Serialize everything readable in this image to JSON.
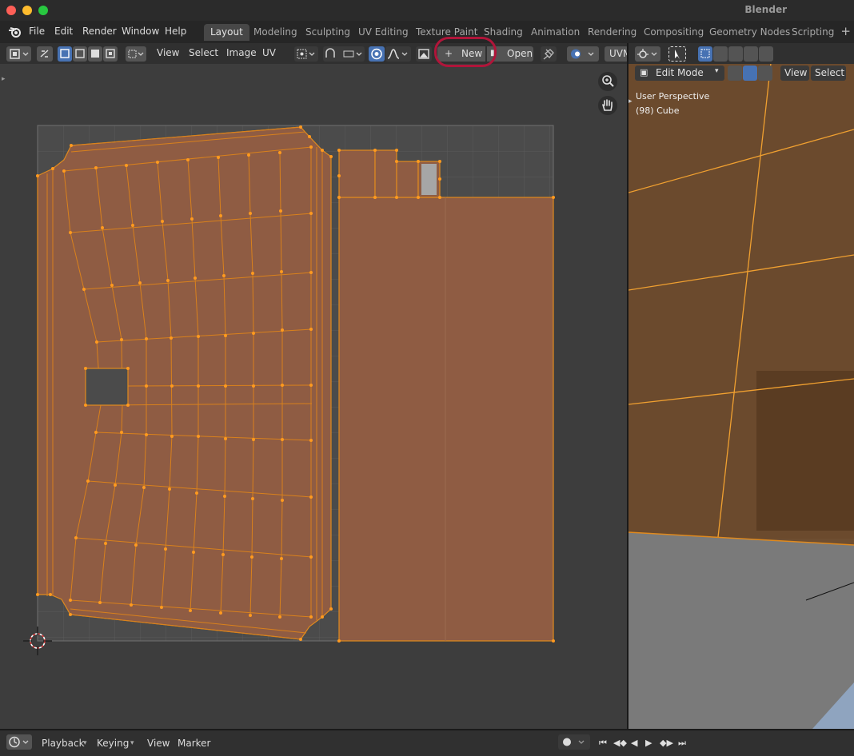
{
  "app": {
    "title": "Blender"
  },
  "menu": {
    "file": "File",
    "edit": "Edit",
    "render": "Render",
    "window": "Window",
    "help": "Help"
  },
  "workspaces": [
    "Layout",
    "Modeling",
    "Sculpting",
    "UV Editing",
    "Texture Paint",
    "Shading",
    "Animation",
    "Rendering",
    "Compositing",
    "Geometry Nodes",
    "Scripting"
  ],
  "uv_header": {
    "view": "View",
    "select": "Select",
    "image": "Image",
    "uv": "UV",
    "new_label": "New",
    "open_label": "Open",
    "uvmap": "UVM"
  },
  "viewport": {
    "mode": "Edit Mode",
    "view": "View",
    "select": "Select",
    "overlay_line1": "User Perspective",
    "overlay_line2": "(98) Cube"
  },
  "timeline": {
    "playback": "Playback",
    "keying": "Keying",
    "view": "View",
    "marker": "Marker"
  },
  "colors": {
    "accent_orange": "#e08a1e",
    "uv_face": "#8f5c43",
    "highlight": "#b0153a",
    "active_blue": "#4772b3"
  },
  "icons": [
    "blender-logo-icon",
    "editor-type-icon",
    "sync-icon",
    "select-mode-icon",
    "pivot-icon",
    "snap-icon",
    "proportional-icon",
    "image-icon",
    "pin-icon",
    "zoom-icon",
    "hand-icon",
    "plus-icon",
    "record-icon"
  ]
}
